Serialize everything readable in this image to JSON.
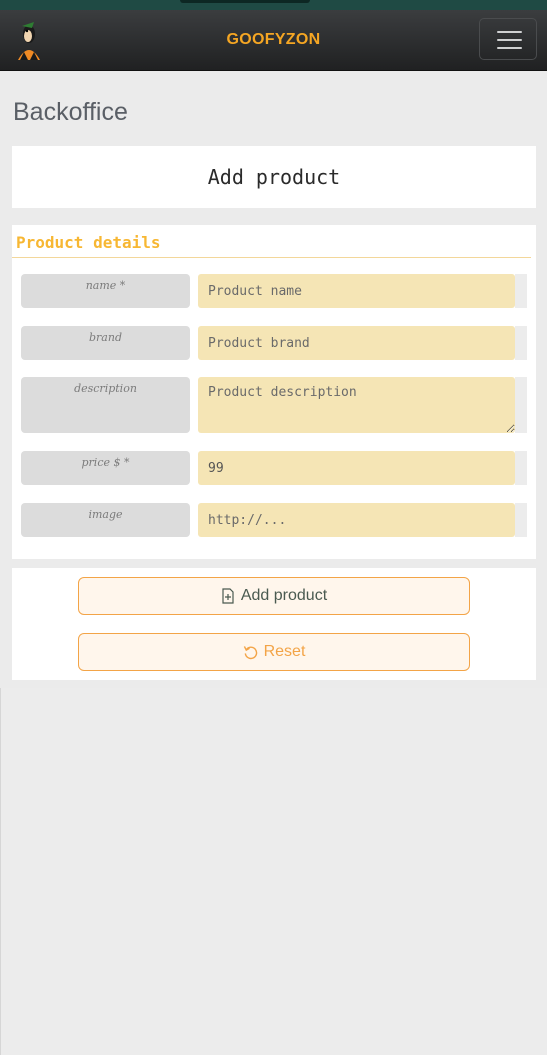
{
  "navbar": {
    "brand": "GOOFYZON",
    "menu_icon": "hamburger-icon",
    "logo_icon": "goofy-logo"
  },
  "page": {
    "title": "Backoffice"
  },
  "header_card": {
    "title": "Add product"
  },
  "form": {
    "legend": "Product details",
    "fields": [
      {
        "label": "name *",
        "placeholder": "Product name",
        "value": ""
      },
      {
        "label": "brand",
        "placeholder": "Product brand",
        "value": ""
      },
      {
        "label": "description",
        "placeholder": "Product description",
        "value": ""
      },
      {
        "label": "price $ *",
        "placeholder": "",
        "value": "99"
      },
      {
        "label": "image",
        "placeholder": "http://...",
        "value": ""
      }
    ]
  },
  "actions": {
    "add_label": "Add product",
    "add_icon": "file-plus-icon",
    "reset_label": "Reset",
    "reset_icon": "rotate-ccw-icon"
  },
  "colors": {
    "accent": "#f7b733",
    "button_border": "#f3a447",
    "input_bg": "#f5e5b5",
    "navbar": "#2c2e30"
  }
}
